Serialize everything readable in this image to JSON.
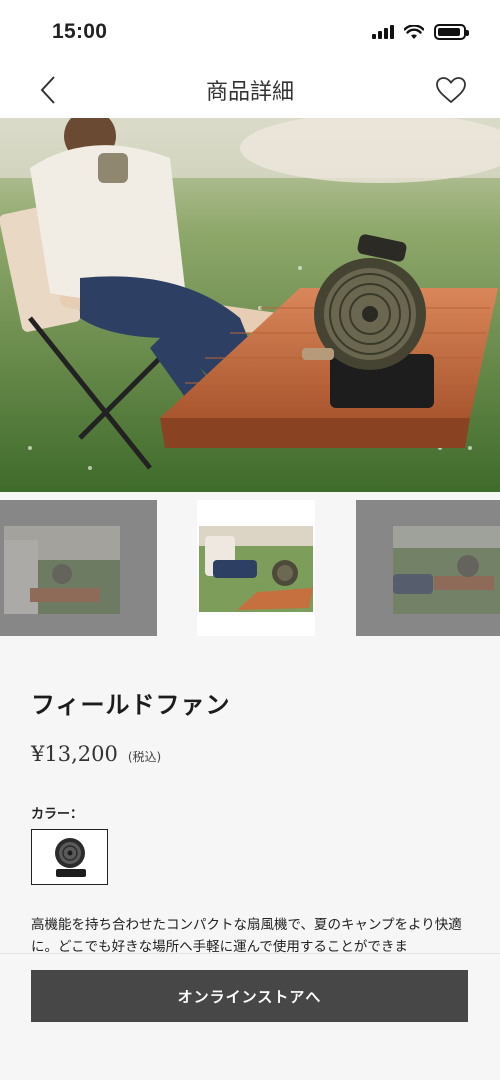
{
  "status_bar": {
    "time": "15:00",
    "battery_level": 0.9,
    "icons": [
      "cellular-signal-icon",
      "wifi-icon",
      "battery-icon"
    ]
  },
  "nav": {
    "title": "商品詳細",
    "back_icon": "chevron-left-icon",
    "favorite_icon": "heart-outline-icon"
  },
  "product": {
    "name": "フィールドファン",
    "price": "¥13,200",
    "tax_note": "(税込)",
    "color_label": "カラー：",
    "description": "高機能を持ち合わせたコンパクトな扇風機で、夏のキャンプをより快適に。どこでも好きな場所へ手軽に運んで使用することができま"
  },
  "gallery": {
    "selected_index": 1,
    "thumbnail_count": 3
  },
  "cta": {
    "label": "オンラインストアへ"
  },
  "colors": {
    "button_bg": "#474747",
    "page_bg": "#f6f6f6"
  }
}
